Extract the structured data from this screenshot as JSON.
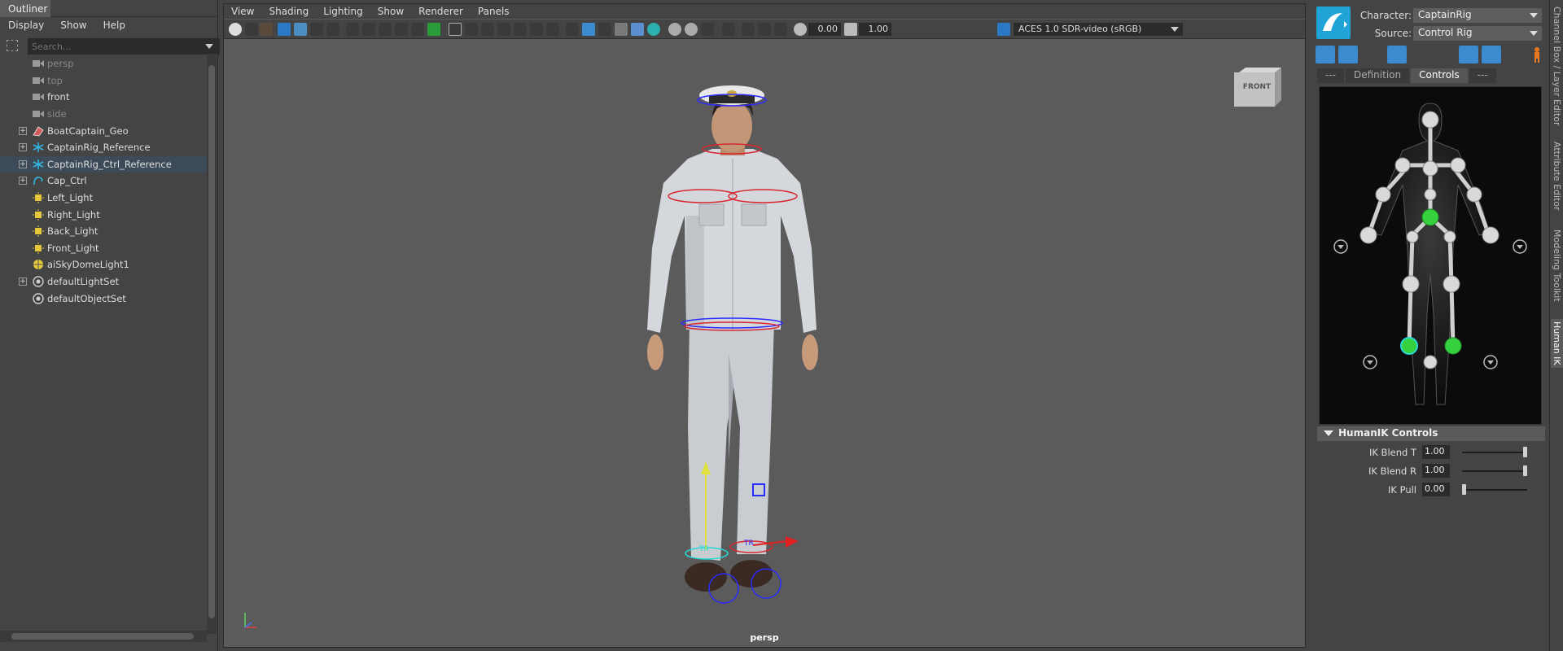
{
  "outliner": {
    "title": "Outliner",
    "menu": [
      "Display",
      "Show",
      "Help"
    ],
    "search_placeholder": "Search...",
    "items": [
      {
        "label": "persp",
        "icon": "camera-icon",
        "dim": true,
        "expandable": false
      },
      {
        "label": "top",
        "icon": "camera-icon",
        "dim": true,
        "expandable": false
      },
      {
        "label": "front",
        "icon": "camera-icon",
        "dim": false,
        "expandable": false
      },
      {
        "label": "side",
        "icon": "camera-icon",
        "dim": true,
        "expandable": false
      },
      {
        "label": "BoatCaptain_Geo",
        "icon": "mesh-icon",
        "dim": false,
        "expandable": true
      },
      {
        "label": "CaptainRig_Reference",
        "icon": "reference-icon",
        "dim": false,
        "expandable": true
      },
      {
        "label": "CaptainRig_Ctrl_Reference",
        "icon": "reference-icon",
        "dim": false,
        "expandable": true,
        "selected": true
      },
      {
        "label": "Cap_Ctrl",
        "icon": "curve-icon",
        "dim": false,
        "expandable": true
      },
      {
        "label": "Left_Light",
        "icon": "light-icon",
        "dim": false,
        "expandable": false
      },
      {
        "label": "Right_Light",
        "icon": "light-icon",
        "dim": false,
        "expandable": false
      },
      {
        "label": "Back_Light",
        "icon": "light-icon",
        "dim": false,
        "expandable": false
      },
      {
        "label": "Front_Light",
        "icon": "light-icon",
        "dim": false,
        "expandable": false
      },
      {
        "label": "aiSkyDomeLight1",
        "icon": "skydome-icon",
        "dim": false,
        "expandable": false
      },
      {
        "label": "defaultLightSet",
        "icon": "set-icon",
        "dim": false,
        "expandable": true
      },
      {
        "label": "defaultObjectSet",
        "icon": "set-icon",
        "dim": false,
        "expandable": false
      }
    ]
  },
  "viewport": {
    "menu": [
      "View",
      "Shading",
      "Lighting",
      "Show",
      "Renderer",
      "Panels"
    ],
    "exposure_value": "0.00",
    "gamma_value": "1.00",
    "color_management": "ACES 1.0 SDR-video (sRGB)",
    "camera_label": "persp",
    "viewcube_face": "FRONT"
  },
  "human_ik": {
    "character_label": "Character:",
    "character_value": "CaptainRig",
    "source_label": "Source:",
    "source_value": "Control Rig",
    "tabs": [
      "---",
      "Definition",
      "Controls",
      "---"
    ],
    "active_tab": "Controls",
    "controls_header": "HumanIK Controls",
    "controls": [
      {
        "label": "IK Blend T",
        "value": "1.00",
        "level": 1.0
      },
      {
        "label": "IK Blend R",
        "value": "1.00",
        "level": 1.0
      },
      {
        "label": "IK Pull",
        "value": "0.00",
        "level": 0.0
      }
    ]
  },
  "side_tabs": [
    "Channel Box / Layer Editor",
    "Attribute Editor",
    "Modeling Toolkit",
    "Human IK"
  ],
  "active_side_tab": "Human IK",
  "colors": {
    "accent_blue": "#20a4d8",
    "selection": "#3d4a58",
    "effector_green": "#36d13f"
  }
}
